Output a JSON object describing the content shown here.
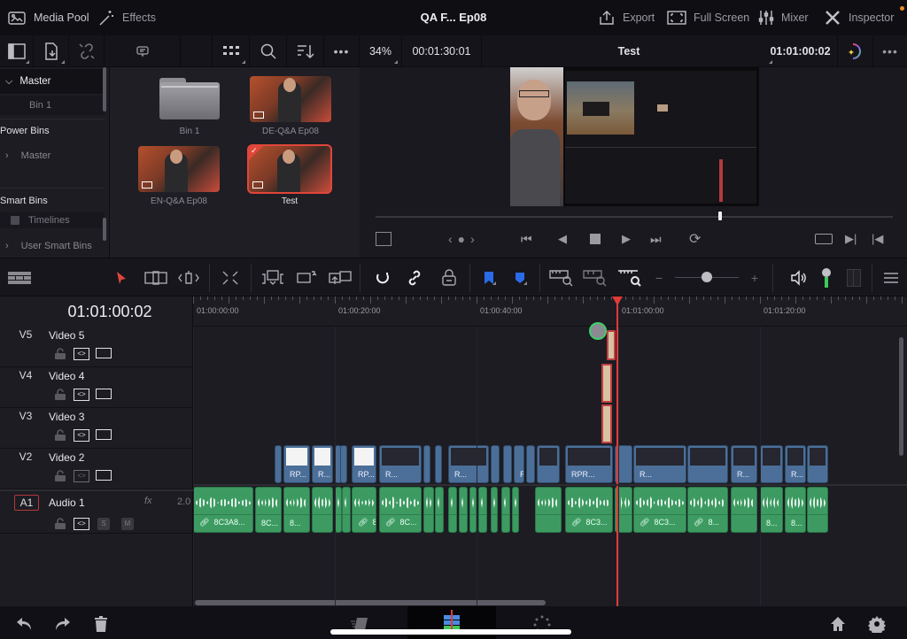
{
  "topbar": {
    "media_pool": "Media Pool",
    "effects": "Effects",
    "title": "QA F... Ep08",
    "export": "Export",
    "full_screen": "Full Screen",
    "mixer": "Mixer",
    "inspector": "Inspector"
  },
  "toolbar2": {
    "zoom_level": "34%",
    "source_timecode": "00:01:30:01",
    "timeline_name": "Test",
    "record_timecode": "01:01:00:02"
  },
  "bins": {
    "master": "Master",
    "bin1": "Bin 1",
    "power_bins": "Power Bins",
    "power_master": "Master",
    "smart_bins": "Smart Bins",
    "timelines": "Timelines",
    "user_smart_bins": "User Smart Bins"
  },
  "media": [
    {
      "label": "Bin 1",
      "type": "folder"
    },
    {
      "label": "DE-Q&A Ep08",
      "type": "timeline"
    },
    {
      "label": "EN-Q&A Ep08",
      "type": "timeline"
    },
    {
      "label": "Test",
      "type": "timeline",
      "selected": true
    }
  ],
  "viewer": {
    "scrub_position": 0.66
  },
  "timeline": {
    "timecode": "01:01:00:02",
    "ruler_labels": [
      "01:00:00:00",
      "01:00:20:00",
      "01:00:40:00",
      "01:01:00:00",
      "01:01:20:00"
    ],
    "zoom_slider": 0.5,
    "tracks": [
      {
        "id": "V5",
        "name": "Video 5"
      },
      {
        "id": "V4",
        "name": "Video 4"
      },
      {
        "id": "V3",
        "name": "Video 3"
      },
      {
        "id": "V2",
        "name": "Video 2"
      },
      {
        "id": "A1",
        "name": "Audio 1",
        "fx": "fx",
        "level": "2.0",
        "solo": "S",
        "mute": "M"
      }
    ],
    "video_clips": [
      "RP...",
      "R...",
      "RP...",
      "R...",
      "R...",
      "RPR...",
      "RPR...",
      "R...",
      "R...",
      "R..."
    ],
    "audio_clips": [
      "8C3A8...",
      "8C...",
      "8...",
      "8C...",
      "8C...",
      "8...",
      "8C3...",
      "8C3...",
      "8...",
      "8...",
      "8..."
    ]
  },
  "colors": {
    "playhead": "#e03a3a",
    "video_clip": "#4b6f98",
    "audio_clip": "#3d9b62",
    "selection": "#e0463a"
  }
}
